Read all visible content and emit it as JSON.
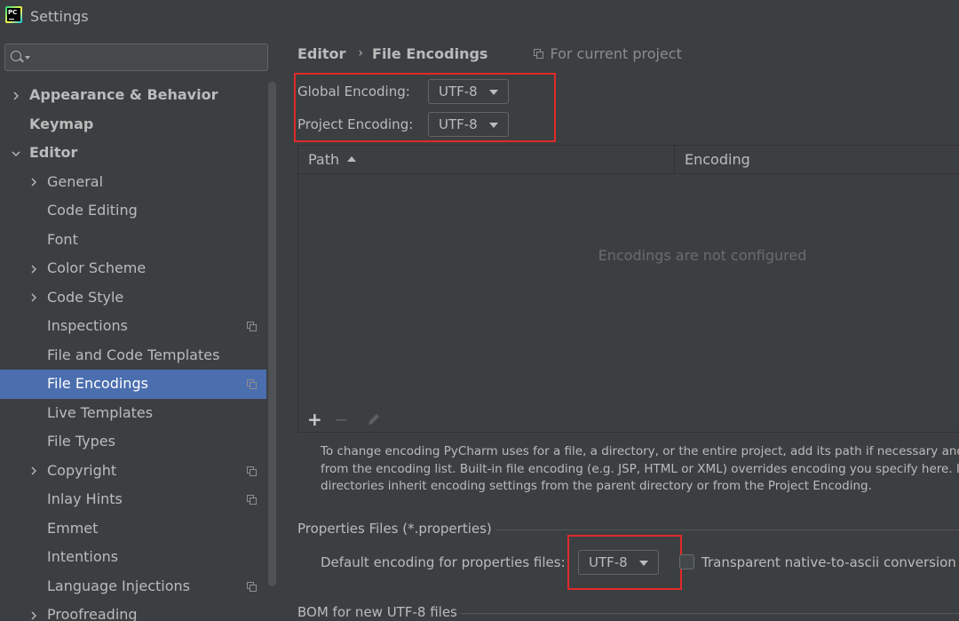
{
  "window": {
    "title": "Settings",
    "logo_text": "PC"
  },
  "sidebar": {
    "search": {
      "value": "",
      "placeholder": ""
    },
    "items": [
      {
        "label": "Appearance & Behavior",
        "chevron": ">"
      },
      {
        "label": "Keymap"
      },
      {
        "label": "Editor",
        "chevron": "v"
      },
      {
        "label": "General",
        "chevron": ">"
      },
      {
        "label": "Code Editing"
      },
      {
        "label": "Font"
      },
      {
        "label": "Color Scheme",
        "chevron": ">"
      },
      {
        "label": "Code Style",
        "chevron": ">"
      },
      {
        "label": "Inspections",
        "icon": "copy-icon"
      },
      {
        "label": "File and Code Templates"
      },
      {
        "label": "File Encodings",
        "icon": "copy-icon",
        "selected": true
      },
      {
        "label": "Live Templates"
      },
      {
        "label": "File Types"
      },
      {
        "label": "Copyright",
        "chevron": ">",
        "icon": "copy-icon"
      },
      {
        "label": "Inlay Hints",
        "icon": "copy-icon"
      },
      {
        "label": "Emmet"
      },
      {
        "label": "Intentions"
      },
      {
        "label": "Language Injections",
        "icon": "copy-icon"
      },
      {
        "label": "Proofreading",
        "chevron": ">"
      }
    ]
  },
  "breadcrumb": {
    "parent": "Editor",
    "separator": "›",
    "current": "File Encodings",
    "scope_label": "For current project"
  },
  "encodings": {
    "global_label": "Global Encoding:",
    "global_value": "UTF-8",
    "project_label": "Project Encoding:",
    "project_value": "UTF-8"
  },
  "table": {
    "columns": [
      "Path",
      "Encoding"
    ],
    "empty_text": "Encodings are not configured",
    "toolbar": {
      "add": "+",
      "remove": "−",
      "edit_icon": "pencil-icon"
    }
  },
  "help_lines": [
    "To change encoding PyCharm uses for a file, a directory, or the entire project, add its path if necessary and th",
    "from the encoding list. Built-in file encoding (e.g. JSP, HTML or XML) overrides encoding you specify here. If n",
    "directories inherit encoding settings from the parent directory or from the Project Encoding."
  ],
  "properties": {
    "section_title": "Properties Files (*.properties)",
    "default_label": "Default encoding for properties files:",
    "default_value": "UTF-8",
    "transparent_label": "Transparent native-to-ascii conversion",
    "transparent_checked": false
  },
  "bom": {
    "section_title": "BOM for new UTF-8 files"
  },
  "colors": {
    "background": "#3c3f41",
    "selection": "#4b6eaf",
    "highlight_box": "#e02a2a",
    "text": "#bbbbbb",
    "muted_text": "#6b6b6b"
  }
}
